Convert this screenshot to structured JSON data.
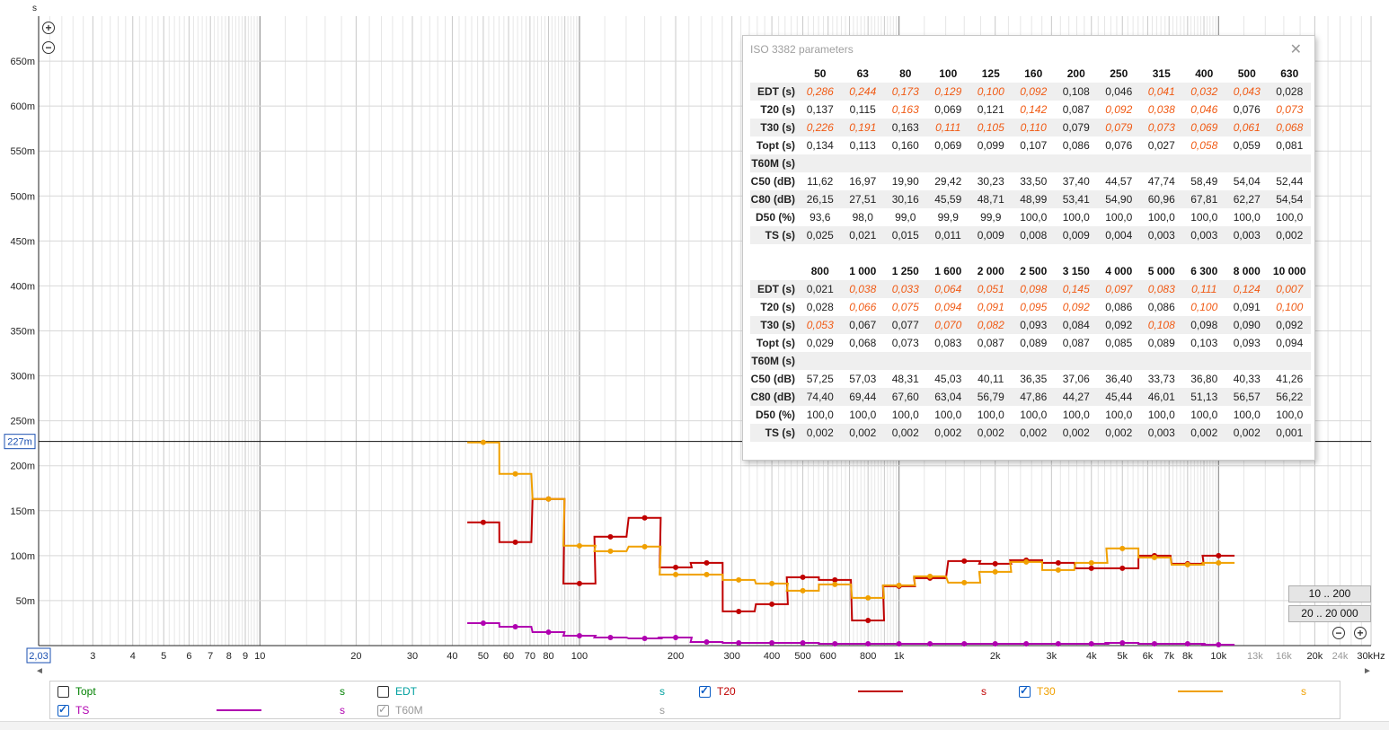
{
  "plot": {
    "y_unit": "s",
    "y_ticks": [
      "650m",
      "600m",
      "550m",
      "500m",
      "450m",
      "400m",
      "350m",
      "300m",
      "250m",
      "200m",
      "150m",
      "100m",
      "50m"
    ],
    "y_tick_values": [
      0.65,
      0.6,
      0.55,
      0.5,
      0.45,
      0.4,
      0.35,
      0.3,
      0.25,
      0.2,
      0.15,
      0.1,
      0.05
    ],
    "cursor_y_label": "227m",
    "cursor_y_value": 0.227,
    "x_left_label": "2,03",
    "x_ticks": [
      {
        "label": "3",
        "v": 3
      },
      {
        "label": "4",
        "v": 4
      },
      {
        "label": "5",
        "v": 5
      },
      {
        "label": "6",
        "v": 6
      },
      {
        "label": "7",
        "v": 7
      },
      {
        "label": "8",
        "v": 8
      },
      {
        "label": "9",
        "v": 9
      },
      {
        "label": "10",
        "v": 10
      },
      {
        "label": "20",
        "v": 20
      },
      {
        "label": "30",
        "v": 30
      },
      {
        "label": "40",
        "v": 40
      },
      {
        "label": "50",
        "v": 50
      },
      {
        "label": "60",
        "v": 60
      },
      {
        "label": "70",
        "v": 70
      },
      {
        "label": "80",
        "v": 80
      },
      {
        "label": "100",
        "v": 100
      },
      {
        "label": "200",
        "v": 200
      },
      {
        "label": "300",
        "v": 300
      },
      {
        "label": "400",
        "v": 400
      },
      {
        "label": "500",
        "v": 500
      },
      {
        "label": "600",
        "v": 600
      },
      {
        "label": "800",
        "v": 800
      },
      {
        "label": "1k",
        "v": 1000
      },
      {
        "label": "2k",
        "v": 2000
      },
      {
        "label": "3k",
        "v": 3000
      },
      {
        "label": "4k",
        "v": 4000
      },
      {
        "label": "5k",
        "v": 5000
      },
      {
        "label": "6k",
        "v": 6000
      },
      {
        "label": "7k",
        "v": 7000
      },
      {
        "label": "8k",
        "v": 8000
      },
      {
        "label": "10k",
        "v": 10000
      },
      {
        "label": "13k",
        "v": 13000,
        "grey": true
      },
      {
        "label": "16k",
        "v": 16000,
        "grey": true
      },
      {
        "label": "20k",
        "v": 20000
      },
      {
        "label": "24k",
        "v": 24000,
        "grey": true
      },
      {
        "label": "30kHz",
        "v": 30000
      }
    ],
    "x_range": [
      2.03,
      30000
    ],
    "y_range": [
      0,
      0.7
    ]
  },
  "chart_data": {
    "type": "line",
    "xlabel": "kHz",
    "ylabel": "s",
    "x": [
      50,
      63,
      80,
      100,
      125,
      160,
      200,
      250,
      315,
      400,
      500,
      630,
      800,
      1000,
      1250,
      1600,
      2000,
      2500,
      3150,
      4000,
      5000,
      6300,
      8000,
      10000
    ],
    "series": [
      {
        "name": "T20",
        "color": "#c00000",
        "values": [
          0.137,
          0.115,
          0.163,
          0.069,
          0.121,
          0.142,
          0.087,
          0.092,
          0.038,
          0.046,
          0.076,
          0.073,
          0.028,
          0.066,
          0.075,
          0.094,
          0.091,
          0.095,
          0.092,
          0.086,
          0.086,
          0.1,
          0.091,
          0.1
        ]
      },
      {
        "name": "T30",
        "color": "#f0a000",
        "values": [
          0.226,
          0.191,
          0.163,
          0.111,
          0.105,
          0.11,
          0.079,
          0.079,
          0.073,
          0.069,
          0.061,
          0.068,
          0.053,
          0.067,
          0.077,
          0.07,
          0.082,
          0.093,
          0.084,
          0.092,
          0.108,
          0.098,
          0.09,
          0.092
        ]
      },
      {
        "name": "TS",
        "color": "#b000b0",
        "values": [
          0.025,
          0.021,
          0.015,
          0.011,
          0.009,
          0.008,
          0.009,
          0.004,
          0.003,
          0.003,
          0.003,
          0.002,
          0.002,
          0.002,
          0.002,
          0.002,
          0.002,
          0.002,
          0.002,
          0.002,
          0.003,
          0.002,
          0.002,
          0.001
        ]
      }
    ]
  },
  "iso": {
    "title": "ISO 3382 parameters",
    "close_glyph": "✕",
    "table1": {
      "headers": [
        "50",
        "63",
        "80",
        "100",
        "125",
        "160",
        "200",
        "250",
        "315",
        "400",
        "500",
        "630"
      ],
      "rows": [
        {
          "label": "EDT (s)",
          "values": [
            "0,286",
            "0,244",
            "0,173",
            "0,129",
            "0,100",
            "0,092",
            "0,108",
            "0,046",
            "0,041",
            "0,032",
            "0,043",
            "0,028"
          ],
          "warn": [
            1,
            1,
            1,
            1,
            1,
            1,
            0,
            0,
            1,
            1,
            1,
            0
          ]
        },
        {
          "label": "T20 (s)",
          "values": [
            "0,137",
            "0,115",
            "0,163",
            "0,069",
            "0,121",
            "0,142",
            "0,087",
            "0,092",
            "0,038",
            "0,046",
            "0,076",
            "0,073"
          ],
          "warn": [
            0,
            0,
            1,
            0,
            0,
            1,
            0,
            1,
            1,
            1,
            0,
            1
          ]
        },
        {
          "label": "T30 (s)",
          "values": [
            "0,226",
            "0,191",
            "0,163",
            "0,111",
            "0,105",
            "0,110",
            "0,079",
            "0,079",
            "0,073",
            "0,069",
            "0,061",
            "0,068"
          ],
          "warn": [
            1,
            1,
            0,
            1,
            1,
            1,
            0,
            1,
            1,
            1,
            1,
            1
          ]
        },
        {
          "label": "Topt (s)",
          "values": [
            "0,134",
            "0,113",
            "0,160",
            "0,069",
            "0,099",
            "0,107",
            "0,086",
            "0,076",
            "0,027",
            "0,058",
            "0,059",
            "0,081"
          ],
          "warn": [
            0,
            0,
            0,
            0,
            0,
            0,
            0,
            0,
            0,
            1,
            0,
            0
          ]
        },
        {
          "label": "T60M (s)",
          "values": [
            "",
            "",
            "",
            "",
            "",
            "",
            "",
            "",
            "",
            "",
            "",
            ""
          ],
          "warn": [
            0,
            0,
            0,
            0,
            0,
            0,
            0,
            0,
            0,
            0,
            0,
            0
          ]
        },
        {
          "label": "C50 (dB)",
          "values": [
            "11,62",
            "16,97",
            "19,90",
            "29,42",
            "30,23",
            "33,50",
            "37,40",
            "44,57",
            "47,74",
            "58,49",
            "54,04",
            "52,44"
          ],
          "warn": [
            0,
            0,
            0,
            0,
            0,
            0,
            0,
            0,
            0,
            0,
            0,
            0
          ]
        },
        {
          "label": "C80 (dB)",
          "values": [
            "26,15",
            "27,51",
            "30,16",
            "45,59",
            "48,71",
            "48,99",
            "53,41",
            "54,90",
            "60,96",
            "67,81",
            "62,27",
            "54,54"
          ],
          "warn": [
            0,
            0,
            0,
            0,
            0,
            0,
            0,
            0,
            0,
            0,
            0,
            0
          ]
        },
        {
          "label": "D50 (%)",
          "values": [
            "93,6",
            "98,0",
            "99,0",
            "99,9",
            "99,9",
            "100,0",
            "100,0",
            "100,0",
            "100,0",
            "100,0",
            "100,0",
            "100,0"
          ],
          "warn": [
            0,
            0,
            0,
            0,
            0,
            0,
            0,
            0,
            0,
            0,
            0,
            0
          ]
        },
        {
          "label": "TS (s)",
          "values": [
            "0,025",
            "0,021",
            "0,015",
            "0,011",
            "0,009",
            "0,008",
            "0,009",
            "0,004",
            "0,003",
            "0,003",
            "0,003",
            "0,002"
          ],
          "warn": [
            0,
            0,
            0,
            0,
            0,
            0,
            0,
            0,
            0,
            0,
            0,
            0
          ]
        }
      ]
    },
    "table2": {
      "headers": [
        "800",
        "1 000",
        "1 250",
        "1 600",
        "2 000",
        "2 500",
        "3 150",
        "4 000",
        "5 000",
        "6 300",
        "8 000",
        "10 000"
      ],
      "rows": [
        {
          "label": "EDT (s)",
          "values": [
            "0,021",
            "0,038",
            "0,033",
            "0,064",
            "0,051",
            "0,098",
            "0,145",
            "0,097",
            "0,083",
            "0,111",
            "0,124",
            "0,007"
          ],
          "warn": [
            0,
            1,
            1,
            1,
            1,
            1,
            1,
            1,
            1,
            1,
            1,
            1
          ]
        },
        {
          "label": "T20 (s)",
          "values": [
            "0,028",
            "0,066",
            "0,075",
            "0,094",
            "0,091",
            "0,095",
            "0,092",
            "0,086",
            "0,086",
            "0,100",
            "0,091",
            "0,100"
          ],
          "warn": [
            0,
            1,
            1,
            1,
            1,
            1,
            1,
            0,
            0,
            1,
            0,
            1
          ]
        },
        {
          "label": "T30 (s)",
          "values": [
            "0,053",
            "0,067",
            "0,077",
            "0,070",
            "0,082",
            "0,093",
            "0,084",
            "0,092",
            "0,108",
            "0,098",
            "0,090",
            "0,092"
          ],
          "warn": [
            1,
            0,
            0,
            1,
            1,
            0,
            0,
            0,
            1,
            0,
            0,
            0
          ]
        },
        {
          "label": "Topt (s)",
          "values": [
            "0,029",
            "0,068",
            "0,073",
            "0,083",
            "0,087",
            "0,089",
            "0,087",
            "0,085",
            "0,089",
            "0,103",
            "0,093",
            "0,094"
          ],
          "warn": [
            0,
            0,
            0,
            0,
            0,
            0,
            0,
            0,
            0,
            0,
            0,
            0
          ]
        },
        {
          "label": "T60M (s)",
          "values": [
            "",
            "",
            "",
            "",
            "",
            "",
            "",
            "",
            "",
            "",
            "",
            ""
          ],
          "warn": [
            0,
            0,
            0,
            0,
            0,
            0,
            0,
            0,
            0,
            0,
            0,
            0
          ]
        },
        {
          "label": "C50 (dB)",
          "values": [
            "57,25",
            "57,03",
            "48,31",
            "45,03",
            "40,11",
            "36,35",
            "37,06",
            "36,40",
            "33,73",
            "36,80",
            "40,33",
            "41,26"
          ],
          "warn": [
            0,
            0,
            0,
            0,
            0,
            0,
            0,
            0,
            0,
            0,
            0,
            0
          ]
        },
        {
          "label": "C80 (dB)",
          "values": [
            "74,40",
            "69,44",
            "67,60",
            "63,04",
            "56,79",
            "47,86",
            "44,27",
            "45,44",
            "46,01",
            "51,13",
            "56,57",
            "56,22"
          ],
          "warn": [
            0,
            0,
            0,
            0,
            0,
            0,
            0,
            0,
            0,
            0,
            0,
            0
          ]
        },
        {
          "label": "D50 (%)",
          "values": [
            "100,0",
            "100,0",
            "100,0",
            "100,0",
            "100,0",
            "100,0",
            "100,0",
            "100,0",
            "100,0",
            "100,0",
            "100,0",
            "100,0"
          ],
          "warn": [
            0,
            0,
            0,
            0,
            0,
            0,
            0,
            0,
            0,
            0,
            0,
            0
          ]
        },
        {
          "label": "TS (s)",
          "values": [
            "0,002",
            "0,002",
            "0,002",
            "0,002",
            "0,002",
            "0,002",
            "0,002",
            "0,002",
            "0,003",
            "0,002",
            "0,002",
            "0,001"
          ],
          "warn": [
            0,
            0,
            0,
            0,
            0,
            0,
            0,
            0,
            0,
            0,
            0,
            0
          ]
        }
      ]
    }
  },
  "range_buttons": [
    "10 .. 200",
    "20 .. 20 000"
  ],
  "zoom": {
    "in": "+",
    "out": "−"
  },
  "legend": [
    {
      "name": "Topt",
      "color": "#008000",
      "checked": false,
      "line": false,
      "unit": "s"
    },
    {
      "name": "EDT",
      "color": "#00a0a0",
      "checked": false,
      "line": false,
      "unit": "s"
    },
    {
      "name": "T20",
      "color": "#c00000",
      "checked": true,
      "line": true,
      "unit": "s"
    },
    {
      "name": "T30",
      "color": "#f0a000",
      "checked": true,
      "line": true,
      "unit": "s"
    },
    {
      "name": "TS",
      "color": "#b000b0",
      "checked": true,
      "line": true,
      "unit": "s"
    },
    {
      "name": "T60M",
      "color": "#999999",
      "checked": "grey",
      "line": false,
      "unit": "s"
    }
  ]
}
